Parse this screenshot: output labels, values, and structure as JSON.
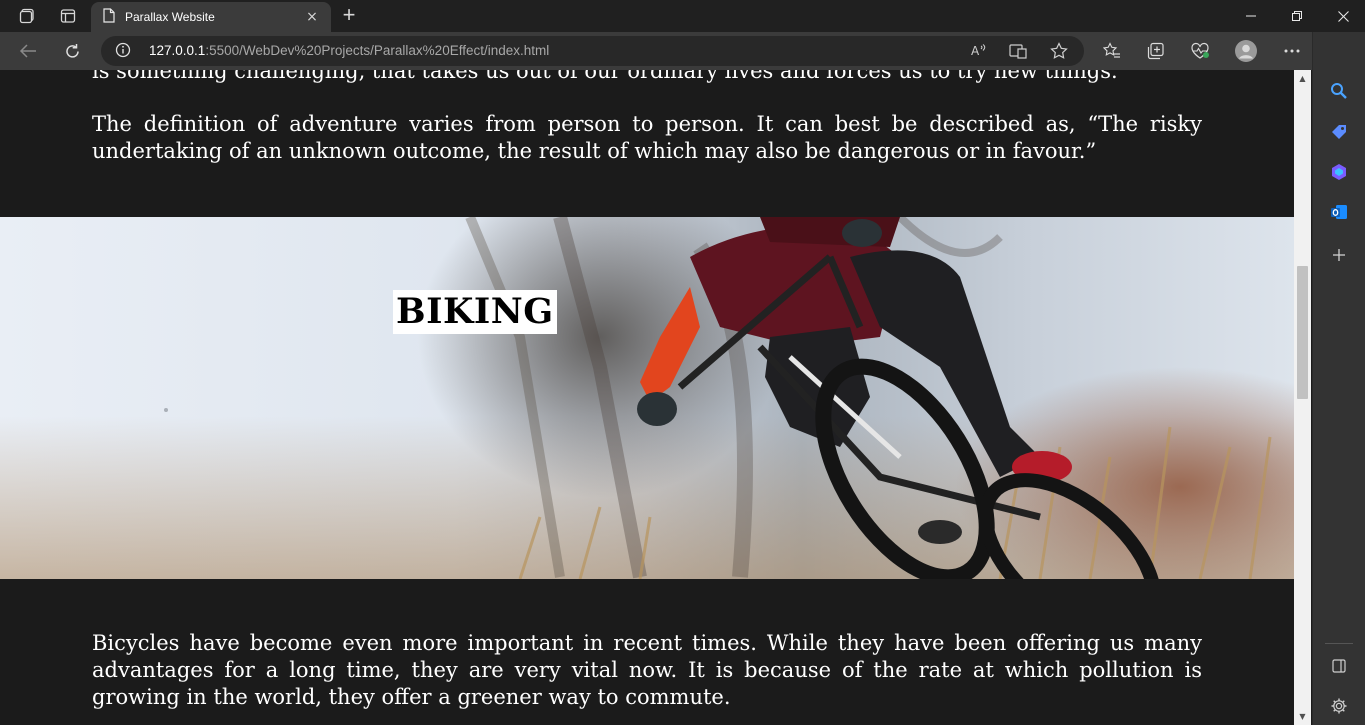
{
  "browser": {
    "tab": {
      "title": "Parallax Website",
      "close_icon": "×"
    },
    "address": {
      "host": "127.0.0.1",
      "path": ":5500/WebDev%20Projects/Parallax%20Effect/index.html"
    }
  },
  "page": {
    "top_partial": "is something challenging, that takes us out of our ordinary lives and forces us to try new things.",
    "definition": "The definition of adventure varies from person to person. It can best be described as, “The risky undertaking of an unknown outcome, the result of which may also be dangerous or in favour.”",
    "banner_title": "BIKING",
    "bicycles": "Bicycles have become even more important in recent times. While they have been offering us many advantages for a long time, they are very vital now. It is because of the rate at which pollution is growing in the world, they offer a greener way to commute."
  },
  "icons": {
    "workspaces": "workspaces-icon",
    "tab_actions": "tab-actions-icon",
    "back": "back-arrow-icon",
    "refresh": "refresh-icon",
    "site_info": "info-icon",
    "read_aloud": "read-aloud-icon",
    "immersive_reader": "immersive-reader-icon",
    "favorite": "star-icon",
    "favorites_bar": "favorites-icon",
    "collections": "collections-icon",
    "performance": "heart-pulse-icon",
    "profile": "profile-avatar-icon",
    "more": "more-icon",
    "bing": "bing-chat-icon"
  },
  "colors": {
    "page_bg": "#1b1b1b",
    "text": "#ffffff",
    "title_bg": "#ffffff",
    "title_text": "#000000",
    "bing_accent": "#1a8cff"
  }
}
